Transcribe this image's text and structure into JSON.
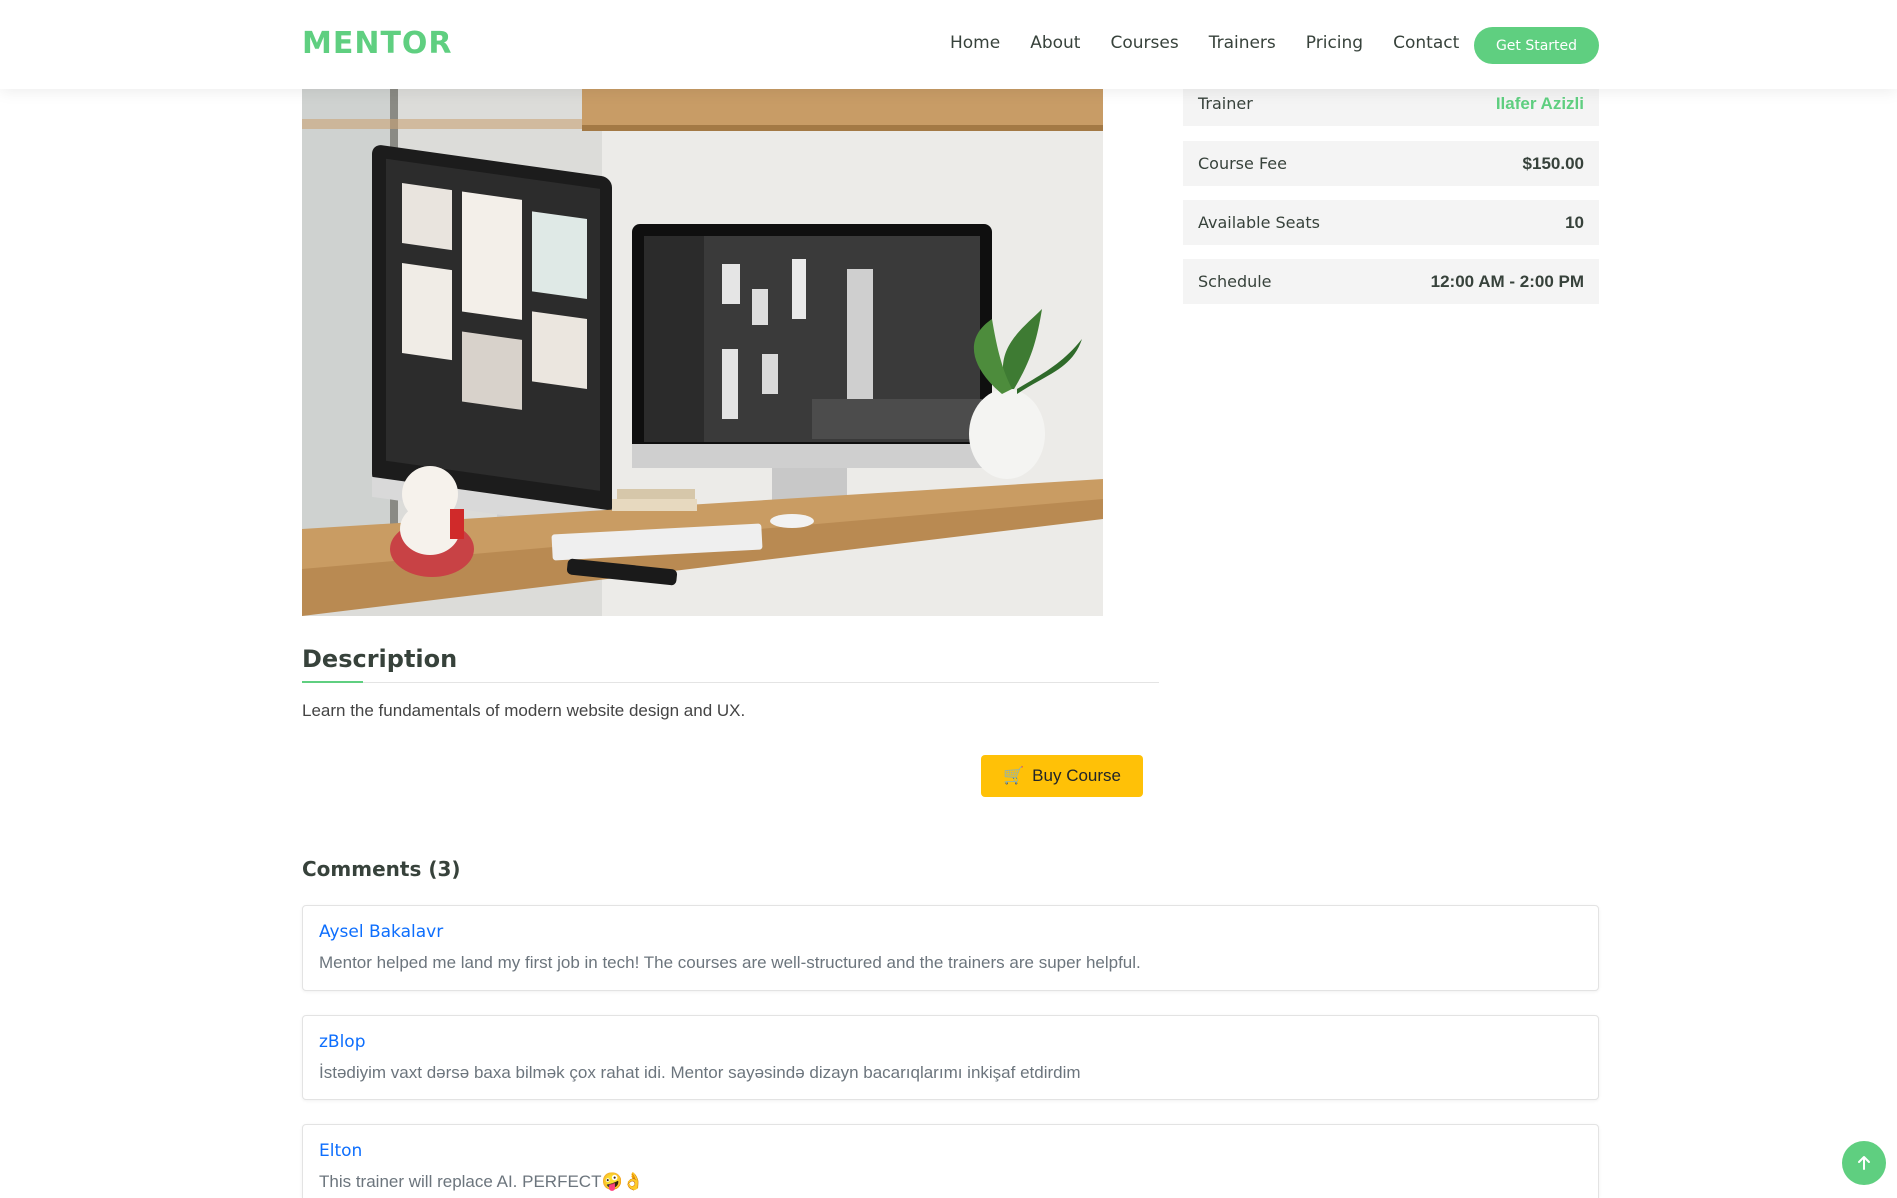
{
  "header": {
    "logo": "MENTOR",
    "nav": [
      "Home",
      "About",
      "Courses",
      "Trainers",
      "Pricing",
      "Contact"
    ],
    "cta": "Get Started"
  },
  "course_info": {
    "trainer_label": "Trainer",
    "trainer_value": "Ilafer Azizli",
    "fee_label": "Course Fee",
    "fee_value": "$150.00",
    "seats_label": "Available Seats",
    "seats_value": "10",
    "schedule_label": "Schedule",
    "schedule_value": "12:00 AM - 2:00 PM"
  },
  "description": {
    "title": "Description",
    "text": "Learn the fundamentals of modern website design and UX."
  },
  "buy": {
    "icon": "🛒",
    "label": "Buy Course"
  },
  "comments": {
    "title": "Comments (3)",
    "items": [
      {
        "author": "Aysel Bakalavr",
        "text": "Mentor helped me land my first job in tech! The courses are well-structured and the trainers are super helpful."
      },
      {
        "author": "zBlop",
        "text": "İstədiyim vaxt dərsə baxa bilmək çox rahat idi. Mentor sayəsində dizayn bacarıqlarımı inkişaf etdirdim"
      },
      {
        "author": "Elton",
        "text": "This trainer will replace AI. PERFECT🤪👌"
      }
    ]
  },
  "colors": {
    "accent": "#5fcf80",
    "buy": "#ffc107",
    "link": "#0d6efd"
  },
  "icons": {
    "scroll_top": "arrow-up-icon",
    "cart": "cart-icon"
  }
}
